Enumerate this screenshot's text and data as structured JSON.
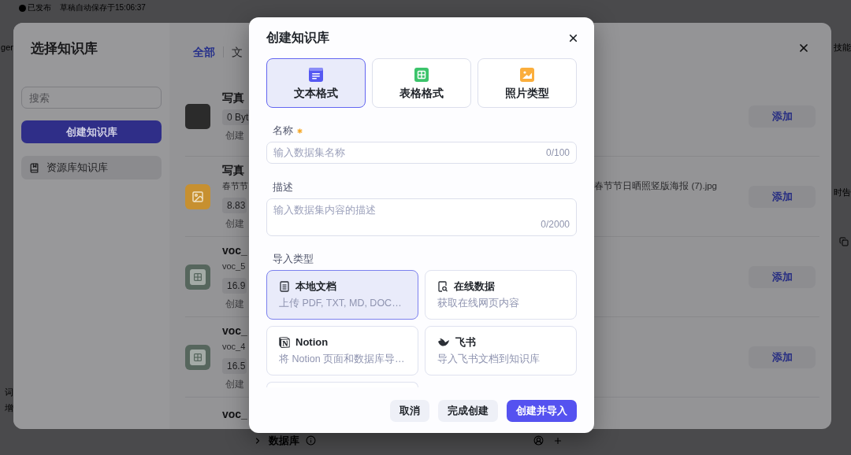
{
  "app_bar": {
    "status": "已发布",
    "autosave": "草稿自动保存于15:06:37"
  },
  "edge_left": {
    "top": "ger",
    "bottom": [
      "词",
      "增"
    ]
  },
  "edge_right": [
    "技能",
    "时告"
  ],
  "app_footer": {
    "section": "数据库"
  },
  "select_dialog": {
    "title": "选择知识库",
    "search": {
      "placeholder": "搜索"
    },
    "create_button": "创建知识库",
    "sidebar_items": [
      {
        "label": "资源库知识库",
        "selected": true
      }
    ],
    "tabs": [
      {
        "label": "全部",
        "selected": true
      },
      {
        "label": "文",
        "selected": false
      }
    ],
    "rows": [
      {
        "kind": "photo",
        "title": "写真",
        "size": "0 Byt",
        "created": "创建",
        "action": "添加"
      },
      {
        "kind": "image",
        "title": "写真",
        "subtitle": "春节节",
        "subtitle_tail": "春节节日晒照竖版海报 (7).jpg",
        "size": "8.83",
        "created": "创建",
        "action": "添加"
      },
      {
        "kind": "table",
        "title": "voc_",
        "subtitle": "voc_5",
        "size": "16.9",
        "created": "创建",
        "action": "添加"
      },
      {
        "kind": "table",
        "title": "voc_",
        "subtitle": "voc_4",
        "size": "16.5",
        "created": "创建",
        "action": "添加"
      },
      {
        "title": "voc_"
      }
    ]
  },
  "create_dialog": {
    "title": "创建知识库",
    "formats": [
      {
        "kind": "text",
        "label": "文本格式",
        "selected": true
      },
      {
        "kind": "table",
        "label": "表格格式",
        "selected": false
      },
      {
        "kind": "photo",
        "label": "照片类型",
        "selected": false
      }
    ],
    "name_field": {
      "label": "名称",
      "required": true,
      "placeholder": "输入数据集名称",
      "counter": "0/100"
    },
    "description_field": {
      "label": "描述",
      "placeholder": "输入数据集内容的描述",
      "counter": "0/2000"
    },
    "import_label": "导入类型",
    "import_types": [
      {
        "kind": "local",
        "title": "本地文档",
        "description": "上传 PDF, TXT, MD, DOC…",
        "selected": true
      },
      {
        "kind": "online",
        "title": "在线数据",
        "description": "获取在线网页内容",
        "selected": false
      },
      {
        "kind": "notion",
        "title": "Notion",
        "description": "将 Notion 页面和数据库导…",
        "selected": false
      },
      {
        "kind": "feishu",
        "title": "飞书",
        "description": "导入飞书文档到知识库",
        "selected": false
      }
    ],
    "buttons": [
      {
        "kind": "secondary",
        "label": "取消"
      },
      {
        "kind": "secondary",
        "label": "完成创建"
      },
      {
        "kind": "primary",
        "label": "创建并导入"
      }
    ]
  }
}
